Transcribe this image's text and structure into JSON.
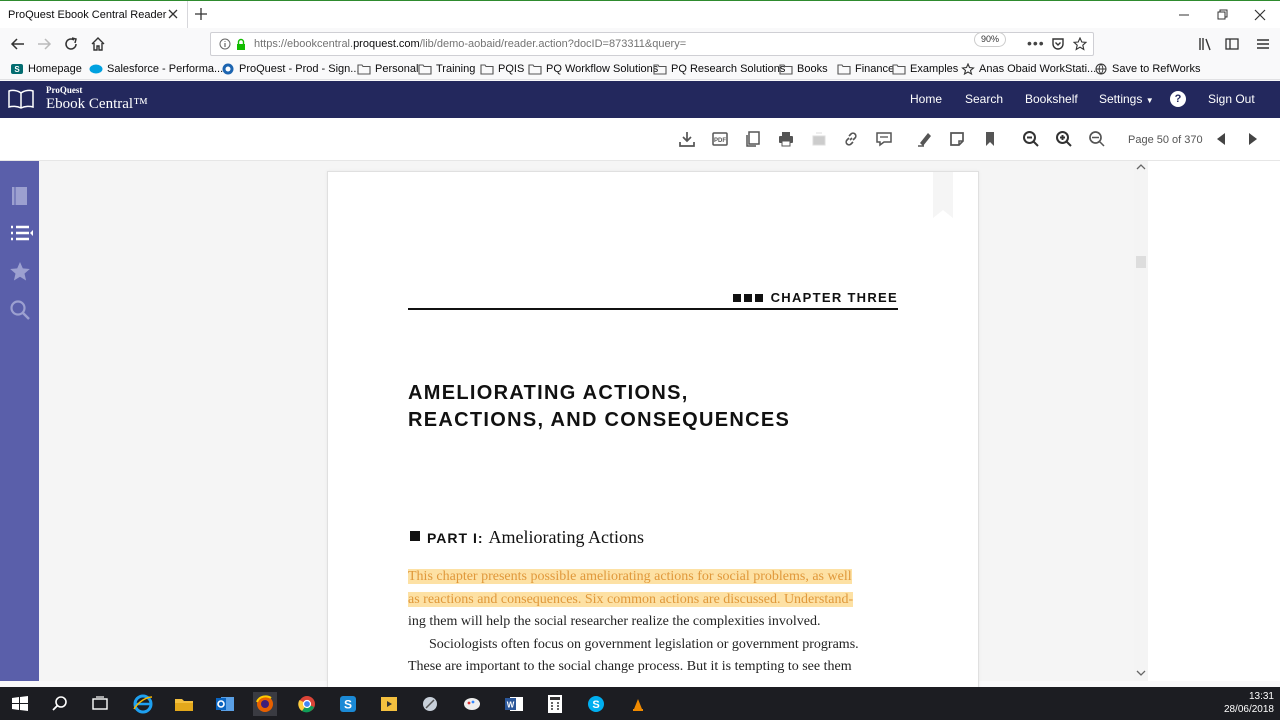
{
  "browser": {
    "tab_title": "ProQuest Ebook Central Reader",
    "url_prefix": "https://ebookcentral.",
    "url_domain": "proquest.com",
    "url_rest": "/lib/demo-aobaid/reader.action?docID=873311&query=",
    "zoom": "90%"
  },
  "bookmarks": [
    {
      "label": "Homepage",
      "icon": "sharepoint-icon"
    },
    {
      "label": "Salesforce - Performa...",
      "icon": "salesforce-icon"
    },
    {
      "label": "ProQuest - Prod - Sign...",
      "icon": "proquest-icon"
    },
    {
      "label": "Personal",
      "icon": "folder-icon"
    },
    {
      "label": "Training",
      "icon": "folder-icon"
    },
    {
      "label": "PQIS",
      "icon": "folder-icon"
    },
    {
      "label": "PQ Workflow Solutions",
      "icon": "folder-icon"
    },
    {
      "label": "PQ Research Solutions",
      "icon": "folder-icon"
    },
    {
      "label": "Books",
      "icon": "folder-icon"
    },
    {
      "label": "Finance",
      "icon": "folder-icon"
    },
    {
      "label": "Examples",
      "icon": "folder-icon"
    },
    {
      "label": "Anas Obaid WorkStati...",
      "icon": "workstation-icon"
    },
    {
      "label": "Save to RefWorks",
      "icon": "globe-icon"
    }
  ],
  "app": {
    "logo_small": "ProQuest",
    "logo_big": "Ebook Central™",
    "nav": [
      "Home",
      "Search",
      "Bookshelf",
      "Settings",
      "Sign Out"
    ]
  },
  "toolbar": {
    "page_indicator": "Page 50 of 370"
  },
  "page": {
    "chapter_label": "CHAPTER THREE",
    "title_line1": "AMELIORATING ACTIONS,",
    "title_line2": "REACTIONS, AND CONSEQUENCES",
    "part_prefix": "PART I:",
    "part_title": "Ameliorating Actions",
    "line1": "This chapter presents possible ameliorating actions for social problems, as well",
    "line2": "as reactions and consequences. Six common actions are discussed. Understand-",
    "line3": "ing them will help the social researcher realize the complexities involved.",
    "line4": "Sociologists often focus on government legislation or government programs.",
    "line5": "These are important to the social change process. But it is tempting to see them"
  },
  "taskbar": {
    "time": "13:31",
    "date": "28/06/2018"
  },
  "colors": {
    "header_bg": "#23285d",
    "rail_bg": "#5a5faa",
    "highlight": "#fde1a4"
  }
}
